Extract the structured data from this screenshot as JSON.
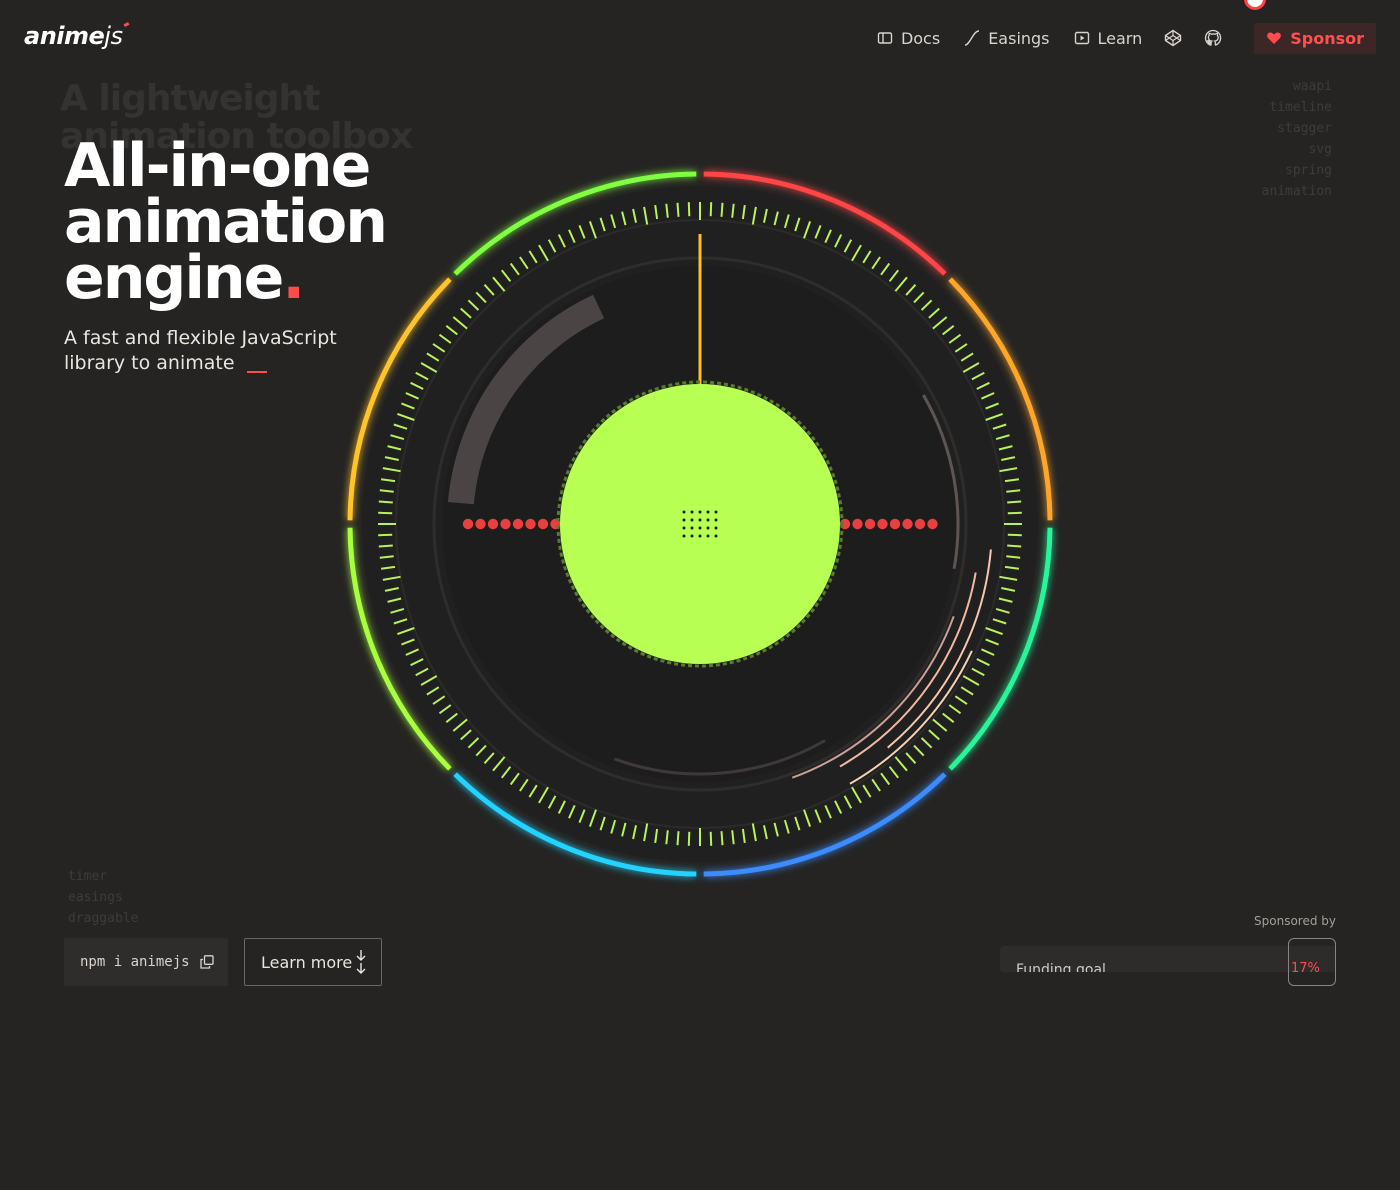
{
  "header": {
    "logo": {
      "bold": "anime",
      "light": "js"
    },
    "nav": [
      {
        "label": "Docs",
        "icon": "book-icon"
      },
      {
        "label": "Easings",
        "icon": "curve-icon"
      },
      {
        "label": "Learn",
        "icon": "play-icon"
      }
    ],
    "codepen_icon": "codepen-icon",
    "github_icon": "github-icon",
    "sponsor_label": "Sponsor"
  },
  "hero": {
    "title_lines": [
      "All-in-one",
      "animation",
      "engine"
    ],
    "title_period": ".",
    "subtitle": "A fast and flexible JavaScript library to animate"
  },
  "ghost": {
    "headline_a": "A lightweight",
    "headline_b": "animation toolbox"
  },
  "side_tags": [
    "waapi",
    "timeline",
    "stagger",
    "svg",
    "spring",
    "animation"
  ],
  "left_tags": [
    "timer",
    "easings",
    "draggable"
  ],
  "install": {
    "command": "npm i animejs"
  },
  "learn_more": {
    "label": "Learn more"
  },
  "sponsors": {
    "label": "Sponsored by",
    "funding_label": "Funding goal",
    "funding_pct": "17%"
  },
  "colors": {
    "background": "#252423",
    "accent": "#ff4b4b",
    "core": "#b7ff52"
  }
}
